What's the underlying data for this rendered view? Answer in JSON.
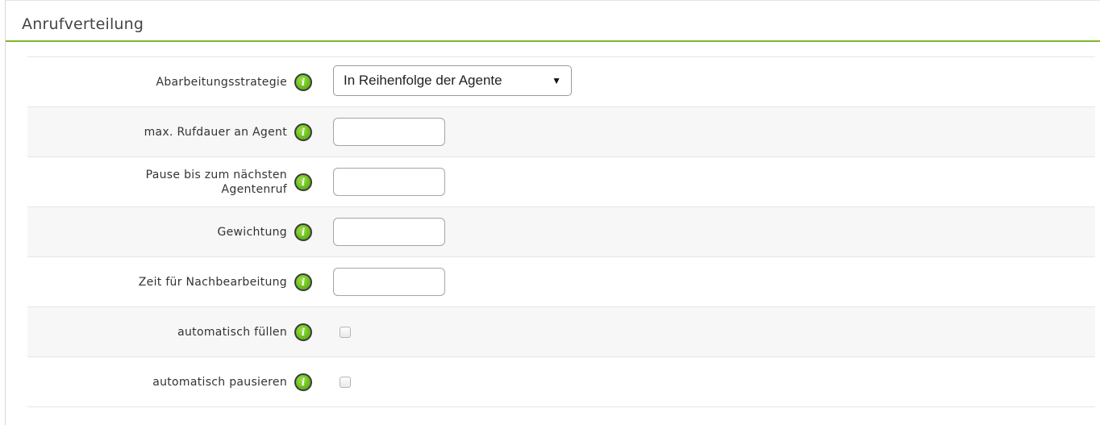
{
  "panel": {
    "title": "Anrufverteilung"
  },
  "fields": {
    "strategy": {
      "label": "Abarbeitungsstrategie",
      "value": "In Reihenfolge der Agente",
      "arrow": "▼",
      "info_icon": "info-icon"
    },
    "max_ring": {
      "label": "max. Rufdauer an Agent",
      "value": "",
      "info_icon": "info-icon"
    },
    "pause_line1": "Pause bis zum nächsten",
    "pause_line2": "Agentenruf",
    "pause": {
      "value": "",
      "info_icon": "info-icon"
    },
    "weight": {
      "label": "Gewichtung",
      "value": "",
      "info_icon": "info-icon"
    },
    "wrapup": {
      "label": "Zeit für Nachbearbeitung",
      "value": "",
      "info_icon": "info-icon"
    },
    "autofill": {
      "label": "automatisch füllen",
      "checked": false,
      "info_icon": "info-icon"
    },
    "autopause": {
      "label": "automatisch pausieren",
      "checked": false,
      "info_icon": "info-icon"
    }
  },
  "info_glyph": "i",
  "colors": {
    "accent": "#7ab929",
    "info_green": "#6cbf1d",
    "alt_row": "#f7f7f7"
  }
}
